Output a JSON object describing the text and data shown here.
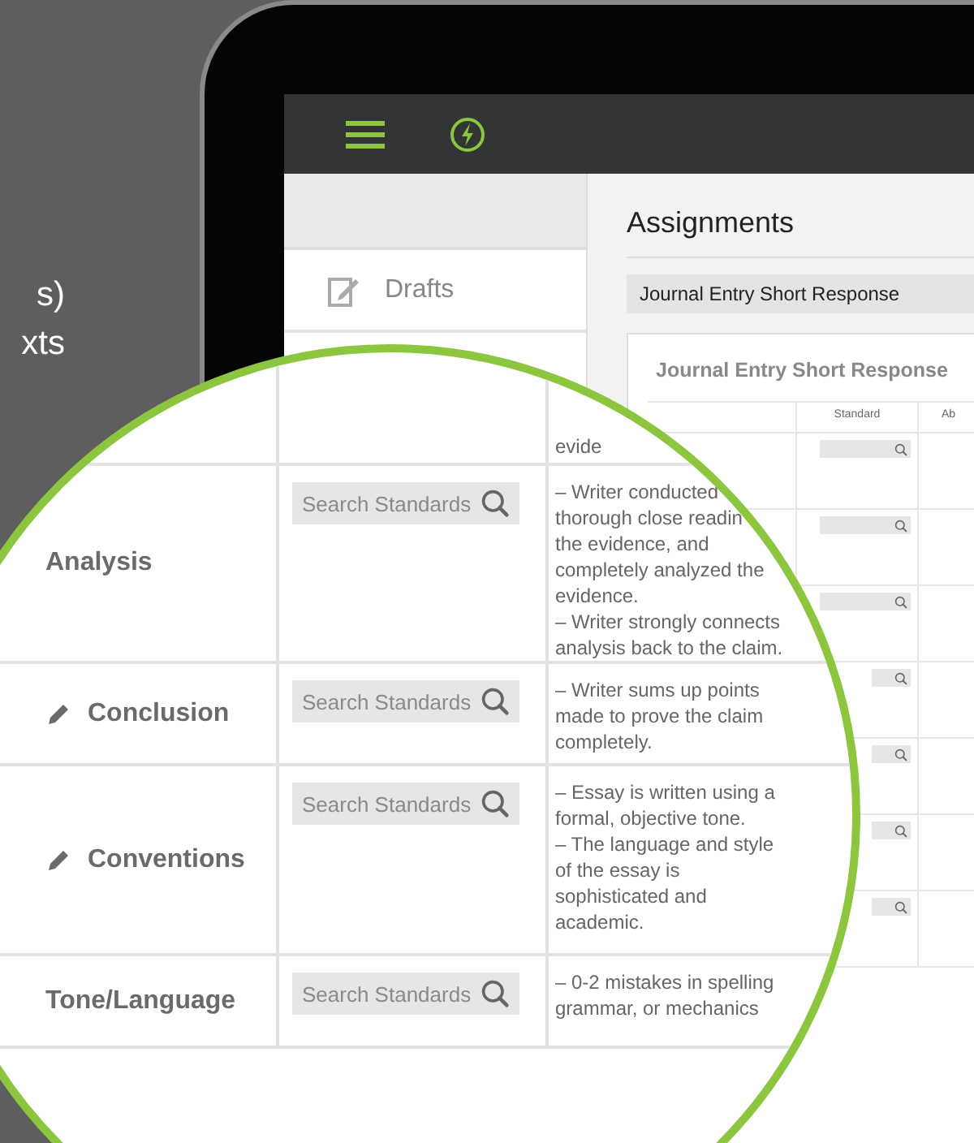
{
  "side_text": [
    "s)",
    "xts"
  ],
  "sidebar": {
    "items": [
      {
        "label": "Drafts"
      }
    ]
  },
  "main": {
    "title": "Assignments",
    "assignment_select": {
      "value": "Journal Entry Short Response"
    },
    "card": {
      "title": "Journal Entry Short Response",
      "columns": [
        "Standard",
        "Ab"
      ]
    }
  },
  "magnifier": {
    "rows": [
      {
        "kind": "plain",
        "description": "evide"
      },
      {
        "kind": "plain",
        "category": "Analysis",
        "standard_placeholder": "Search Standards",
        "description": "– Writer conducted\nthorough close readin\nthe evidence, and\ncompletely analyzed the\nevidence.\n– Writer strongly connects\nanalysis back to the claim."
      },
      {
        "kind": "editable",
        "category": "Conclusion",
        "standard_placeholder": "Search Standards",
        "description": "– Writer sums up points\nmade to prove the claim\ncompletely."
      },
      {
        "kind": "editable",
        "category": "Conventions",
        "standard_placeholder": "Search Standards",
        "description": "– Essay is written using a\nformal, objective tone.\n– The language and style\nof the essay is\nsophisticated and\nacademic."
      },
      {
        "kind": "plain",
        "category": "Tone/Language",
        "standard_placeholder": "Search Standards",
        "description": "– 0-2 mistakes in spelling\ngrammar, or mechanics"
      }
    ]
  }
}
